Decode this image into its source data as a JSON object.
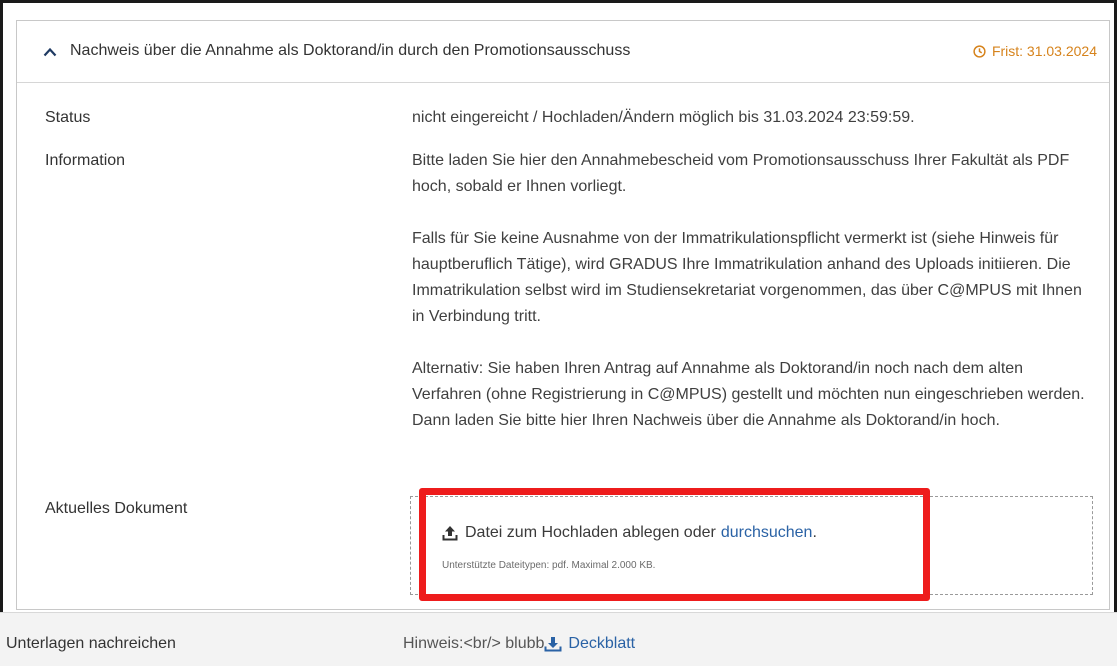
{
  "header": {
    "title": "Nachweis über die Annahme als Doktorand/in durch den Promotionsausschuss",
    "deadline": "Frist: 31.03.2024"
  },
  "rows": {
    "status_label": "Status",
    "status_value": "nicht eingereicht / Hochladen/Ändern möglich bis 31.03.2024 23:59:59.",
    "info_label": "Information",
    "info_paragraphs": [
      "Bitte laden Sie hier den Annahmebescheid vom Promotionsausschuss Ihrer Fakultät als PDF hoch, sobald er Ihnen vorliegt.",
      "Falls für Sie keine Ausnahme von der Immatrikulationspflicht vermerkt ist (siehe Hinweis für hauptberuflich Tätige), wird GRADUS Ihre Immatrikulation anhand des Uploads initiieren. Die Immatrikulation selbst wird im Studiensekretariat vorgenommen, das über C@MPUS mit Ihnen in Verbindung tritt.",
      "Alternativ: Sie haben Ihren Antrag auf Annahme als Doktorand/in noch nach dem alten Verfahren (ohne Registrierung in C@MPUS) gestellt und möchten nun eingeschrieben werden. Dann laden Sie bitte hier Ihren Nachweis über die Annahme als Doktorand/in hoch."
    ],
    "document_label": "Aktuelles Dokument"
  },
  "dropzone": {
    "text": "Datei zum Hochladen ablegen oder",
    "browse_link": "durchsuchen",
    "period": ".",
    "hint": "Unterstützte Dateitypen: pdf. Maximal 2.000 KB."
  },
  "footer": {
    "label": "Unterlagen nachreichen",
    "hint": "Hinweis:<br/> blubb",
    "cover_link": "Deckblatt"
  },
  "colors": {
    "accent_orange": "#d6831c",
    "link_blue": "#2a62a5",
    "highlight_red": "#ee1c1c"
  }
}
